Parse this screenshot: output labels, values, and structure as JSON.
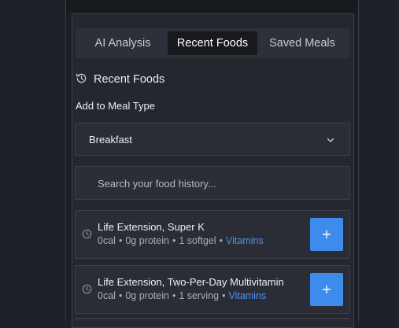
{
  "tabs": [
    {
      "label": "AI Analysis",
      "active": false
    },
    {
      "label": "Recent Foods",
      "active": true
    },
    {
      "label": "Saved Meals",
      "active": false
    }
  ],
  "section": {
    "title": "Recent Foods",
    "icon": "history-icon"
  },
  "meal_type": {
    "label": "Add to Meal Type",
    "selected": "Breakfast"
  },
  "search": {
    "placeholder": "Search your food history...",
    "value": ""
  },
  "foods": [
    {
      "name": "Life Extension, Super K",
      "calories": "0cal",
      "protein": "0g protein",
      "serving": "1 softgel",
      "category": "Vitamins"
    },
    {
      "name": "Life Extension, Two-Per-Day Multivitamin",
      "calories": "0cal",
      "protein": "0g protein",
      "serving": "1 serving",
      "category": "Vitamins"
    }
  ],
  "colors": {
    "accent": "#3d8bea",
    "category_text": "#4f8ff0",
    "background": "#24272e"
  }
}
